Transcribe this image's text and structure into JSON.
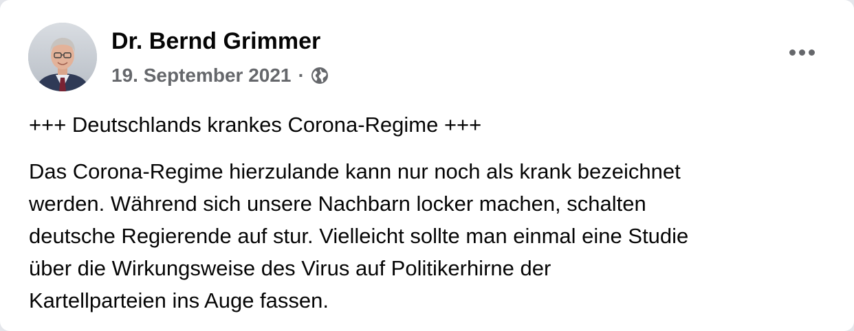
{
  "post": {
    "author": {
      "name": "Dr. Bernd Grimmer",
      "avatar": "profile-photo"
    },
    "meta": {
      "date": "19. September 2021",
      "separator": "·",
      "audience_icon": "globe-icon"
    },
    "more_icon": "more-options-icon",
    "heading": "+++ Deutschlands krankes Corona-Regime +++",
    "body_lines": [
      "Das Corona-Regime hierzulande kann nur noch als krank bezeichnet",
      "werden. Während sich unsere Nachbarn locker machen, schalten",
      "deutsche Regierende auf stur. Vielleicht sollte man einmal eine Studie",
      "über die Wirkungsweise des Virus auf Politikerhirne der",
      "Kartellparteien ins Auge fassen."
    ]
  },
  "colors": {
    "background": "#ffffff",
    "primary_text": "#050505",
    "secondary_text": "#65676b"
  }
}
